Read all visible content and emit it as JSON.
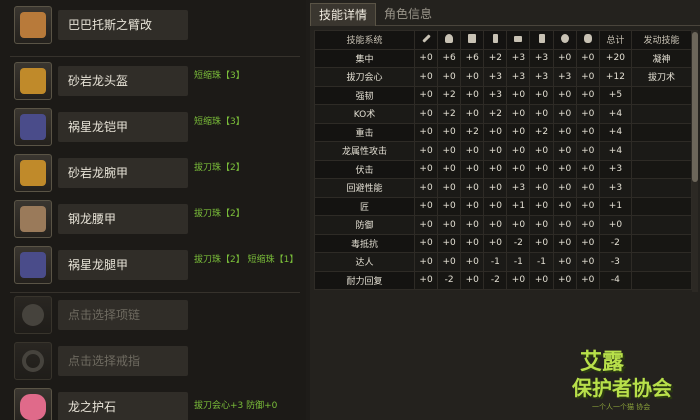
{
  "weapon": {
    "name": "巴巴托斯之臂改",
    "color": "#b87a3a"
  },
  "armor": [
    {
      "name": "砂岩龙头盔",
      "skill": "短缩珠【3】",
      "color": "#c08a2a"
    },
    {
      "name": "祸星龙铠甲",
      "skill": "短缩珠【3】",
      "color": "#4a4c8a"
    },
    {
      "name": "砂岩龙腕甲",
      "skill": "拔刀珠【2】",
      "color": "#c08a2a"
    },
    {
      "name": "钢龙腰甲",
      "skill": "拔刀珠【2】",
      "color": "#9a7a5a"
    },
    {
      "name": "祸星龙腿甲",
      "skill": "拔刀珠【2】  短缩珠【1】",
      "color": "#4a4c8a"
    }
  ],
  "accessories": [
    {
      "name": "点击选择项链",
      "skill": ""
    },
    {
      "name": "点击选择戒指",
      "skill": ""
    },
    {
      "name": "龙之护石",
      "skill": "拔刀会心+3  防御+0"
    }
  ],
  "tabs": {
    "active": "技能详情",
    "inactive": "角色信息"
  },
  "table": {
    "header_name": "技能系统",
    "header_total": "总计",
    "header_active": "发动技能",
    "rows": [
      {
        "name": "集中",
        "vals": [
          "+0",
          "+6",
          "+6",
          "+2",
          "+3",
          "+3",
          "+0",
          "+0"
        ],
        "total": "+20",
        "active": "凝神"
      },
      {
        "name": "拔刀会心",
        "vals": [
          "+0",
          "+0",
          "+0",
          "+3",
          "+3",
          "+3",
          "+3",
          "+0"
        ],
        "total": "+12",
        "active": "拔刀术"
      },
      {
        "name": "强韧",
        "vals": [
          "+0",
          "+2",
          "+0",
          "+3",
          "+0",
          "+0",
          "+0",
          "+0"
        ],
        "total": "+5",
        "active": ""
      },
      {
        "name": "KO术",
        "vals": [
          "+0",
          "+2",
          "+0",
          "+2",
          "+0",
          "+0",
          "+0",
          "+0"
        ],
        "total": "+4",
        "active": ""
      },
      {
        "name": "重击",
        "vals": [
          "+0",
          "+0",
          "+2",
          "+0",
          "+0",
          "+2",
          "+0",
          "+0"
        ],
        "total": "+4",
        "active": ""
      },
      {
        "name": "龙属性攻击",
        "vals": [
          "+0",
          "+0",
          "+0",
          "+0",
          "+0",
          "+0",
          "+0",
          "+0"
        ],
        "total": "+4",
        "active": ""
      },
      {
        "name": "伏击",
        "vals": [
          "+0",
          "+0",
          "+0",
          "+0",
          "+0",
          "+0",
          "+0",
          "+0"
        ],
        "total": "+3",
        "active": ""
      },
      {
        "name": "回避性能",
        "vals": [
          "+0",
          "+0",
          "+0",
          "+0",
          "+3",
          "+0",
          "+0",
          "+0"
        ],
        "total": "+3",
        "active": ""
      },
      {
        "name": "匠",
        "vals": [
          "+0",
          "+0",
          "+0",
          "+0",
          "+1",
          "+0",
          "+0",
          "+0"
        ],
        "total": "+1",
        "active": ""
      },
      {
        "name": "防御",
        "vals": [
          "+0",
          "+0",
          "+0",
          "+0",
          "+0",
          "+0",
          "+0",
          "+0"
        ],
        "total": "+0",
        "active": ""
      },
      {
        "name": "毒抵抗",
        "vals": [
          "+0",
          "+0",
          "+0",
          "+0",
          "-2",
          "+0",
          "+0",
          "+0"
        ],
        "total": "-2",
        "active": ""
      },
      {
        "name": "达人",
        "vals": [
          "+0",
          "+0",
          "+0",
          "-1",
          "-1",
          "-1",
          "+0",
          "+0"
        ],
        "total": "-3",
        "active": ""
      },
      {
        "name": "耐力回复",
        "vals": [
          "+0",
          "-2",
          "+0",
          "-2",
          "+0",
          "+0",
          "+0",
          "+0"
        ],
        "total": "-4",
        "active": ""
      }
    ]
  },
  "logo": {
    "line1": "艾露",
    "line2": "保护者协会",
    "sub": "一个人一个猫 协会"
  }
}
